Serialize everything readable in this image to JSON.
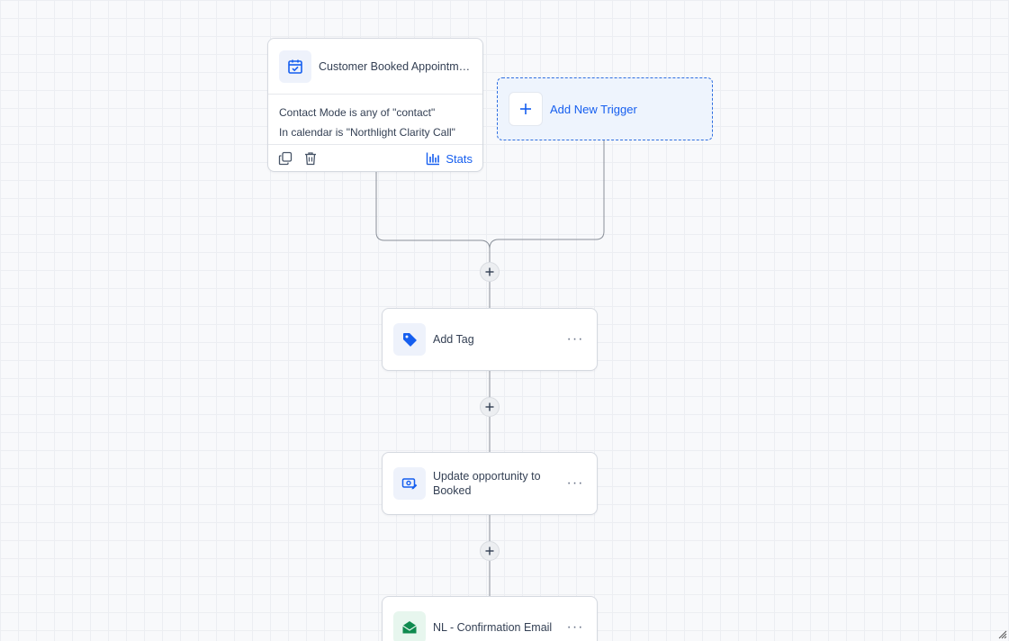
{
  "trigger": {
    "title": "Customer Booked Appointment",
    "conditions": [
      "Contact Mode is any of \"contact\"",
      "In calendar is \"Northlight Clarity Call\""
    ],
    "stats_label": "Stats"
  },
  "add_trigger": {
    "label": "Add New Trigger"
  },
  "actions": [
    {
      "label": "Add Tag",
      "icon": "tag-icon"
    },
    {
      "label": "Update opportunity to Booked",
      "icon": "opportunity-icon"
    },
    {
      "label": "NL - Confirmation Email",
      "icon": "email-icon"
    }
  ],
  "colors": {
    "accent": "#155eef",
    "email_green": "#0f8a4f",
    "canvas_bg": "#f8f9fb"
  }
}
